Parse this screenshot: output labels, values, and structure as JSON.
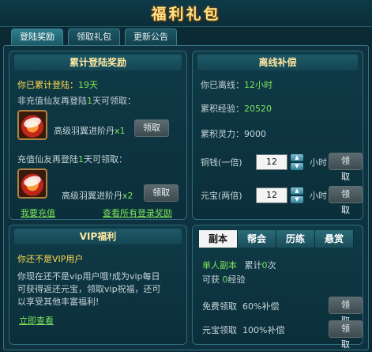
{
  "window": {
    "title": "福利礼包"
  },
  "tabs": [
    {
      "label": "登陆奖励",
      "active": true
    },
    {
      "label": "领取礼包",
      "active": false
    },
    {
      "label": "更新公告",
      "active": false
    }
  ],
  "login_panel": {
    "title": "累计登陆奖励",
    "cumulative_prefix": "你已累计登陆：",
    "cumulative_value": "19天",
    "nonrecharge_a": "非充值仙友再登陆",
    "nonrecharge_days": "1",
    "nonrecharge_b": "天可领取：",
    "item1_name": "高级羽翼进阶丹",
    "item1_count": "x1",
    "claim_label_1": "领取",
    "recharge_a": "充值仙友再登陆",
    "recharge_days": "1",
    "recharge_b": "天可领取：",
    "item2_name": "高级羽翼进阶丹",
    "item2_count": "x2",
    "claim_label_2": "领取",
    "recharge_link": "我要充值",
    "view_all_link": "查看所有登录奖励"
  },
  "offline_panel": {
    "title": "离线补偿",
    "offline_prefix": "你已离线：",
    "offline_value": "12小时",
    "exp_prefix": "累积经验：",
    "exp_value": "20520",
    "spirit_prefix": "累积灵力：",
    "spirit_value": "9000",
    "copper_label": "铜钱(一倍)",
    "copper_hours": "12",
    "copper_unit": "小时",
    "copper_claim": "领取",
    "ingot_label": "元宝(两倍)",
    "ingot_hours": "12",
    "ingot_unit": "小时",
    "ingot_claim": "领取"
  },
  "vip_panel": {
    "title": "VIP福利",
    "status": "你还不是VIP用户",
    "desc_line1": "你现在还不是vip用户哦!成为vip每日",
    "desc_line2": "可获得返还元宝，领取vip祝福，还可",
    "desc_line3": "以享受其他丰富福利!",
    "link": "立即查看"
  },
  "activity_panel": {
    "subtabs": [
      {
        "label": "副本",
        "active": true
      },
      {
        "label": "帮会",
        "active": false
      },
      {
        "label": "历练",
        "active": false
      },
      {
        "label": "悬赏",
        "active": false
      }
    ],
    "dungeon_name": "单人副本",
    "count_prefix": "累计",
    "count_value": "0",
    "count_suffix": "次",
    "exp_prefix": "可获",
    "exp_value": "0",
    "exp_suffix": "经验",
    "free_label": "免费领取",
    "free_rate": "60%补偿",
    "free_claim": "领取",
    "ingot_label": "元宝领取",
    "ingot_rate": "100%补偿",
    "ingot_claim": "领取"
  }
}
